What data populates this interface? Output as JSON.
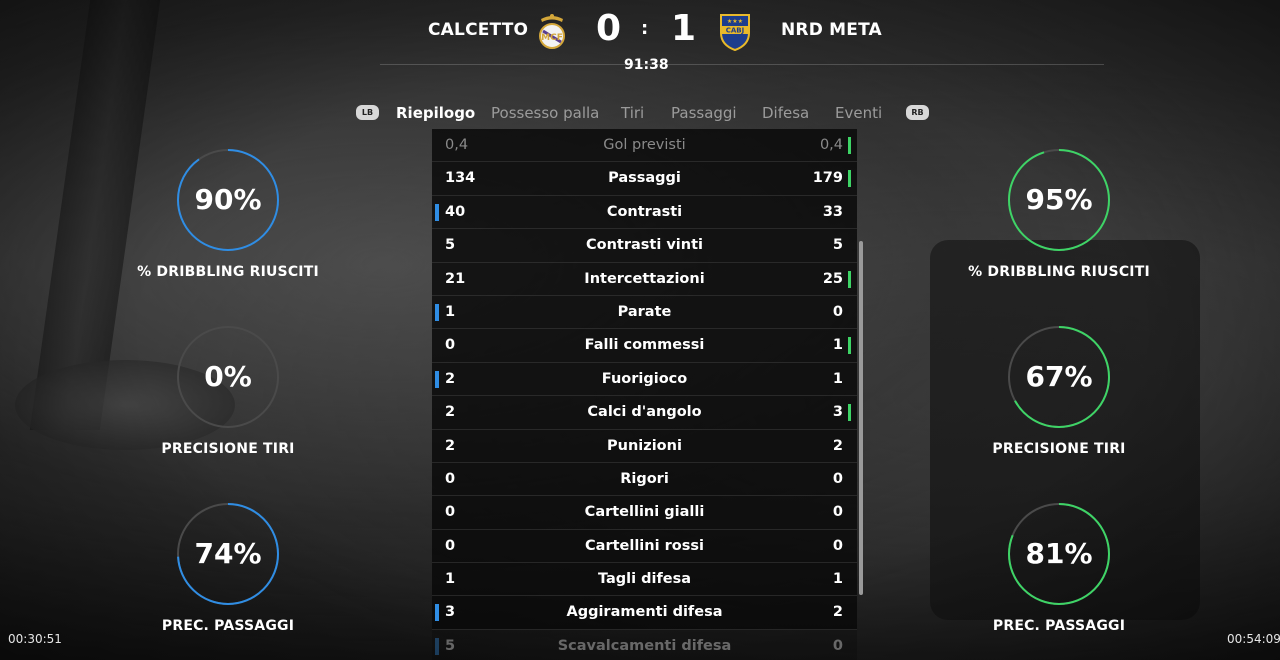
{
  "header": {
    "home_team": "CALCETTO",
    "away_team": "NRD META",
    "home_score": "0",
    "away_score": "1",
    "separator": ":",
    "match_time": "91:38",
    "home_crest_icon": "real-madrid-crest-icon",
    "away_crest_icon": "boca-juniors-crest-icon",
    "away_crest_text": "CABJ"
  },
  "tabs": {
    "lb": "LB",
    "rb": "RB",
    "items": [
      "Riepilogo",
      "Possesso palla",
      "Tiri",
      "Passaggi",
      "Difesa",
      "Eventi"
    ],
    "active": "Riepilogo"
  },
  "home_stats": [
    {
      "value": "90%",
      "label": "% DRIBBLING RIUSCITI",
      "fraction": 0.9
    },
    {
      "value": "0%",
      "label": "PRECISIONE TIRI",
      "fraction": 0.0
    },
    {
      "value": "74%",
      "label": "PREC. PASSAGGI",
      "fraction": 0.74
    }
  ],
  "away_stats": [
    {
      "value": "95%",
      "label": "% DRIBBLING RIUSCITI",
      "fraction": 0.95
    },
    {
      "value": "67%",
      "label": "PRECISIONE TIRI",
      "fraction": 0.67
    },
    {
      "value": "81%",
      "label": "PREC. PASSAGGI",
      "fraction": 0.81
    }
  ],
  "table": {
    "rows": [
      {
        "name": "Gol previsti",
        "home": "0,4",
        "away": "0,4",
        "leader": "away"
      },
      {
        "name": "Passaggi",
        "home": "134",
        "away": "179",
        "leader": "away"
      },
      {
        "name": "Contrasti",
        "home": "40",
        "away": "33",
        "leader": "home"
      },
      {
        "name": "Contrasti vinti",
        "home": "5",
        "away": "5",
        "leader": "none"
      },
      {
        "name": "Intercettazioni",
        "home": "21",
        "away": "25",
        "leader": "away"
      },
      {
        "name": "Parate",
        "home": "1",
        "away": "0",
        "leader": "home"
      },
      {
        "name": "Falli commessi",
        "home": "0",
        "away": "1",
        "leader": "away"
      },
      {
        "name": "Fuorigioco",
        "home": "2",
        "away": "1",
        "leader": "home"
      },
      {
        "name": "Calci d'angolo",
        "home": "2",
        "away": "3",
        "leader": "away"
      },
      {
        "name": "Punizioni",
        "home": "2",
        "away": "2",
        "leader": "none"
      },
      {
        "name": "Rigori",
        "home": "0",
        "away": "0",
        "leader": "none"
      },
      {
        "name": "Cartellini gialli",
        "home": "0",
        "away": "0",
        "leader": "none"
      },
      {
        "name": "Cartellini rossi",
        "home": "0",
        "away": "0",
        "leader": "none"
      },
      {
        "name": "Tagli difesa",
        "home": "1",
        "away": "1",
        "leader": "none"
      },
      {
        "name": "Aggiramenti difesa",
        "home": "3",
        "away": "2",
        "leader": "home"
      },
      {
        "name": "Scavalcamenti difesa",
        "home": "5",
        "away": "0",
        "leader": "home"
      }
    ]
  },
  "corners": {
    "left_time": "00:30:51",
    "right_time": "00:54:09"
  },
  "colors": {
    "home_accent": "#2f8de4",
    "away_accent": "#3ed466"
  }
}
